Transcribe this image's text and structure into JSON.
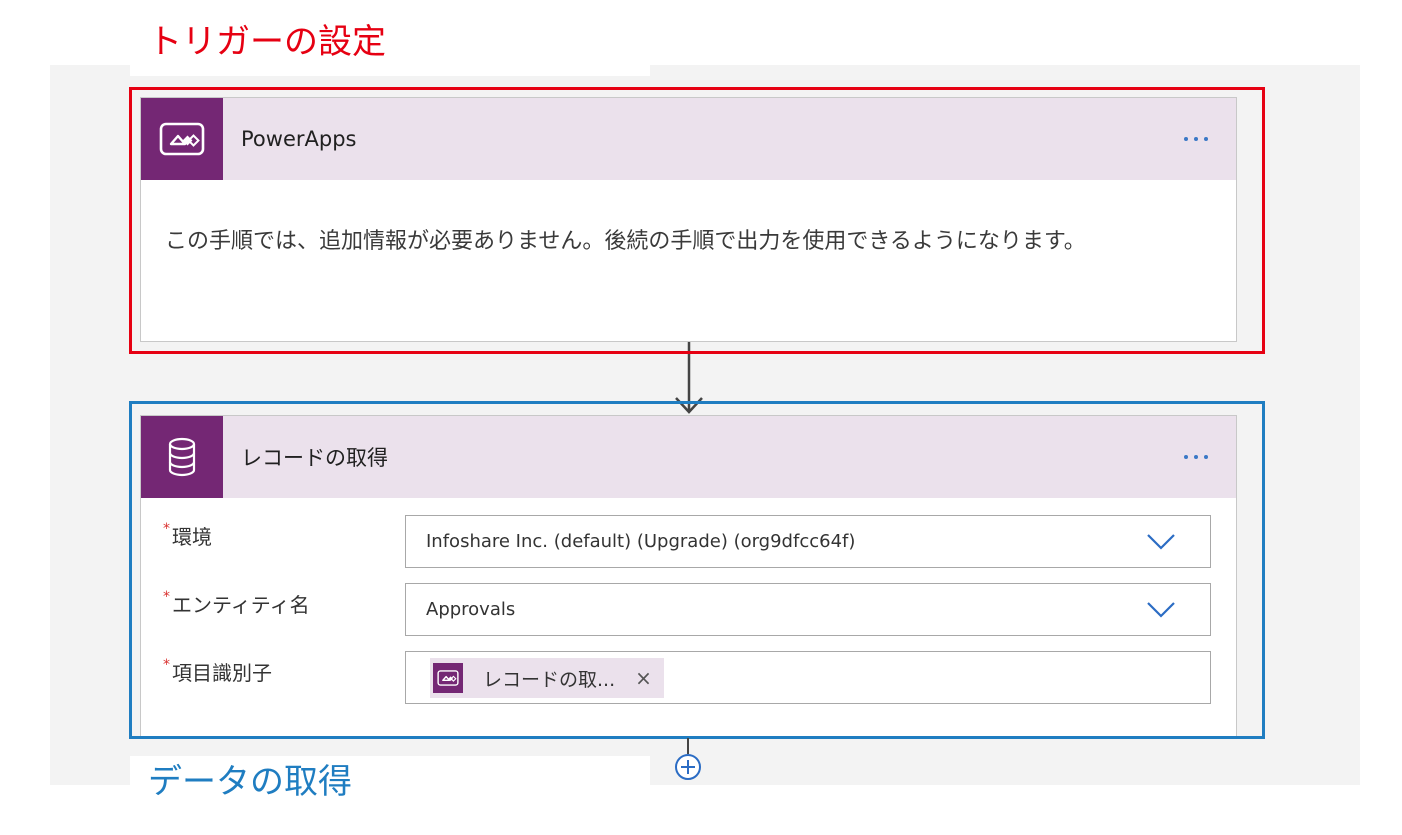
{
  "annotations": {
    "trigger_label": "トリガーの設定",
    "data_label": "データの取得",
    "trigger_color": "#e60012",
    "data_color": "#1f7dc1"
  },
  "colors": {
    "brand_purple": "#742774",
    "header_bg": "#ebe1ec",
    "link_blue": "#3b78c6",
    "canvas_bg": "#f3f3f3"
  },
  "trigger_card": {
    "title": "PowerApps",
    "icon": "powerapps-icon",
    "more_icon": "ellipsis-icon",
    "body": "この手順では、追加情報が必要ありません。後続の手順で出力を使用できるようになります。"
  },
  "action_card": {
    "title": "レコードの取得",
    "icon": "database-icon",
    "more_icon": "ellipsis-icon",
    "fields": [
      {
        "label": "環境",
        "required_mark": "*",
        "value": "Infoshare Inc. (default) (Upgrade) (org9dfcc64f)",
        "control": "dropdown"
      },
      {
        "label": "エンティティ名",
        "required_mark": "*",
        "value": "Approvals",
        "control": "dropdown"
      },
      {
        "label": "項目識別子",
        "required_mark": "*",
        "token": "レコードの取...",
        "token_icon": "powerapps-icon",
        "token_remove": "×"
      }
    ]
  },
  "add_step_icon": "plus-circle-icon"
}
